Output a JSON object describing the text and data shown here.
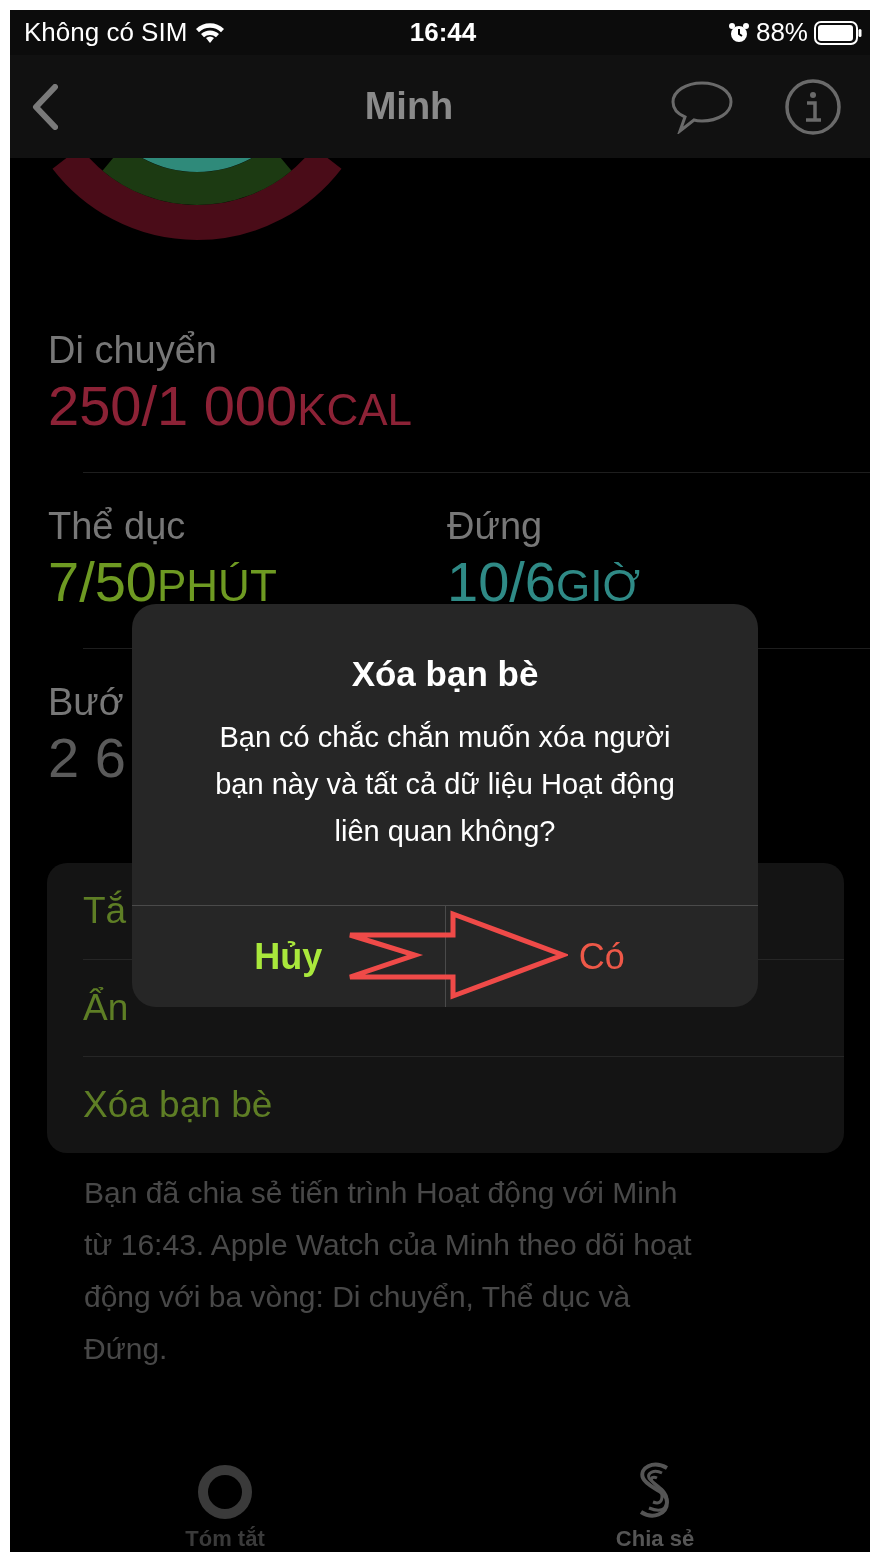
{
  "status_bar": {
    "carrier": "Không có SIM",
    "time": "16:44",
    "battery": "88%"
  },
  "nav": {
    "title": "Minh"
  },
  "metric_rows": [
    {
      "items": [
        {
          "label": "Di chuyển",
          "value": "250/1 000",
          "unit": "KCAL",
          "color": "#8c2236"
        }
      ]
    },
    {
      "items": [
        {
          "label": "Thể dục",
          "value": "7/50",
          "unit": "PHÚT",
          "color": "#6e9a22"
        },
        {
          "label": "Đứng",
          "value": "10/6",
          "unit": "GIỜ",
          "color": "#2f8a86"
        }
      ]
    },
    {
      "items": [
        {
          "label": "Bướ",
          "value": "2 6",
          "color": "#5a5a5a"
        }
      ]
    }
  ],
  "options": [
    "Tắ",
    "Ẩn",
    "Xóa bạn bè"
  ],
  "footer_note": "Bạn đã chia sẻ tiến trình Hoạt động với Minh từ 16:43. Apple Watch của Minh theo dõi hoạt động với ba vòng: Di chuyển, Thể dục và Đứng.",
  "tabs": [
    {
      "label": "Tóm tắt",
      "kind": "summary",
      "selected": false
    },
    {
      "label": "Chia sẻ",
      "kind": "sharing",
      "selected": true
    }
  ],
  "dialog": {
    "title": "Xóa bạn bè",
    "message": "Bạn có chắc chắn muốn xóa người bạn này và tất cả dữ liệu Hoạt động liên quan không?",
    "buttons": [
      {
        "label": "Hủy",
        "kind": "cancel"
      },
      {
        "label": "Có",
        "kind": "destructive"
      }
    ]
  }
}
